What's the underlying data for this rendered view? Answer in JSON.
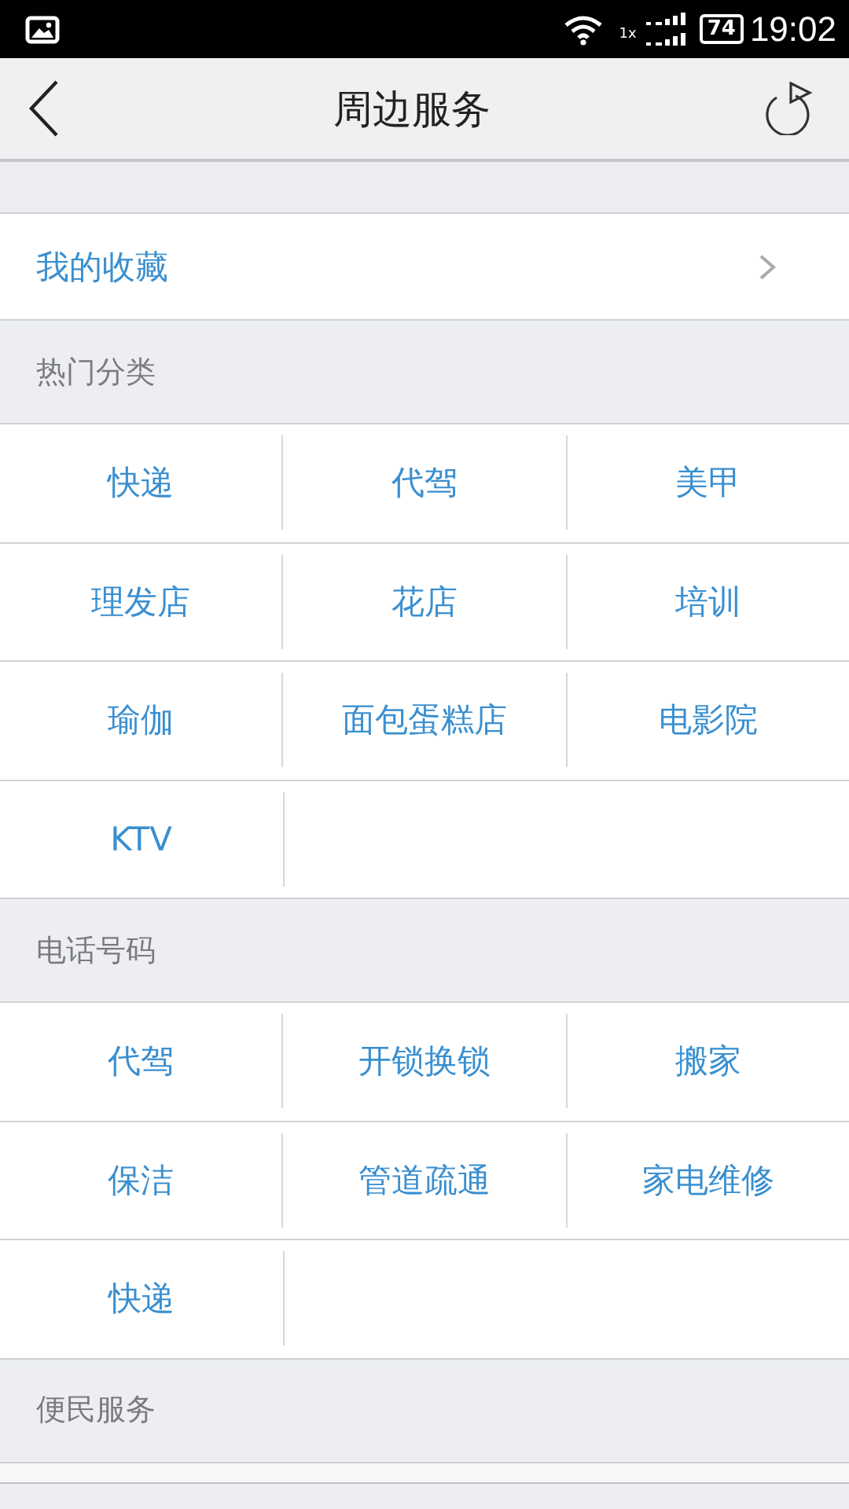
{
  "status_bar": {
    "time": "19:02",
    "battery": "74",
    "network": "1x"
  },
  "header": {
    "title": "周边服务"
  },
  "favorites": {
    "label": "我的收藏"
  },
  "sections": [
    {
      "title": "热门分类",
      "items": [
        "快递",
        "代驾",
        "美甲",
        "理发店",
        "花店",
        "培训",
        "瑜伽",
        "面包蛋糕店",
        "电影院",
        "KTV"
      ]
    },
    {
      "title": "电话号码",
      "items": [
        "代驾",
        "开锁换锁",
        "搬家",
        "保洁",
        "管道疏通",
        "家电维修",
        "快递"
      ]
    },
    {
      "title": "便民服务"
    }
  ]
}
